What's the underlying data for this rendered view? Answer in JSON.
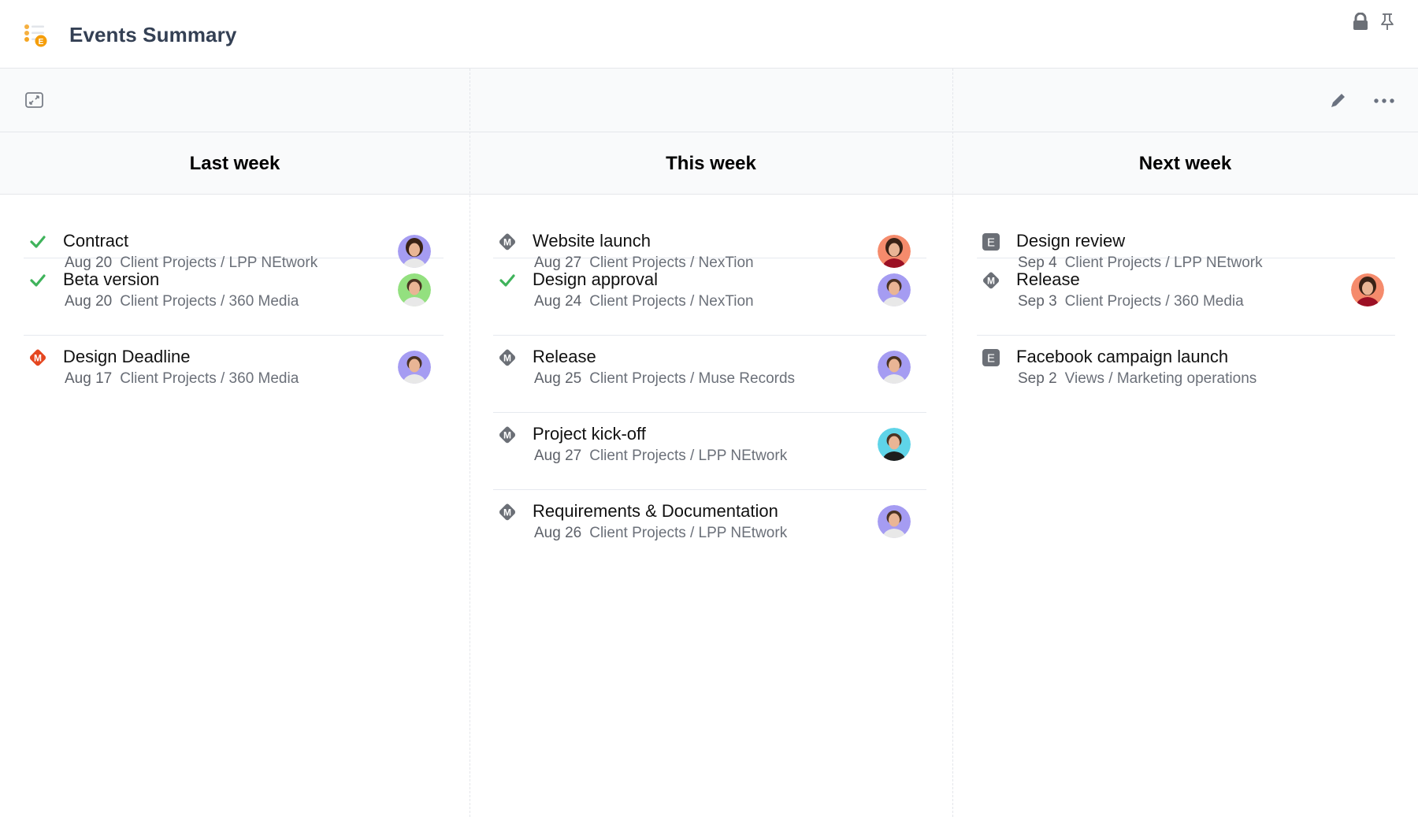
{
  "app": {
    "title": "Events Summary",
    "logo_icon": "list-events-icon",
    "accent_color": "#f59e0b"
  },
  "header_actions": [
    {
      "name": "lock",
      "icon": "lock-icon"
    },
    {
      "name": "pin",
      "icon": "pin-icon"
    }
  ],
  "toolbar": {
    "expand_icon": "expand-icon",
    "edit_icon": "pencil-icon",
    "more_icon": "more-horizontal-icon"
  },
  "status_colors": {
    "done": "#3fb35b",
    "milestone_overdue": "#e5461f",
    "milestone": "#6b6f76",
    "event": "#6b6f76"
  },
  "columns": [
    {
      "label": "Last week",
      "items": [
        {
          "title": "Contract",
          "date": "Aug 20",
          "path": "Client Projects / LPP NEtwork",
          "type": "done",
          "avatar": "woman-brown-hair",
          "avatar_bg": "#a59cf2"
        },
        {
          "title": "Beta version",
          "date": "Aug 20",
          "path": "Client Projects / 360 Media",
          "type": "done",
          "avatar": "man-short-hair",
          "avatar_bg": "#93e07f"
        },
        {
          "title": "Design Deadline",
          "date": "Aug 17",
          "path": "Client Projects / 360 Media",
          "type": "milestone_overdue",
          "badge": "M",
          "avatar": "man-curly-glasses",
          "avatar_bg": "#a59cf2"
        }
      ]
    },
    {
      "label": "This week",
      "items": [
        {
          "title": "Website launch",
          "date": "Aug 27",
          "path": "Client Projects / NexTion",
          "type": "milestone",
          "badge": "M",
          "avatar": "woman-dark-hair",
          "avatar_bg": "#f58b6c"
        },
        {
          "title": "Design approval",
          "date": "Aug 24",
          "path": "Client Projects / NexTion",
          "type": "done",
          "avatar": "man-curly-glasses",
          "avatar_bg": "#a59cf2"
        },
        {
          "title": "Release",
          "date": "Aug 25",
          "path": "Client Projects / Muse Records",
          "type": "milestone",
          "badge": "M",
          "avatar": "man-curly-glasses",
          "avatar_bg": "#a59cf2"
        },
        {
          "title": "Project kick-off",
          "date": "Aug 27",
          "path": "Client Projects / LPP NEtwork",
          "type": "milestone",
          "badge": "M",
          "avatar": "man-dark-tshirt",
          "avatar_bg": "#5fd4e8"
        },
        {
          "title": "Requirements & Documentation",
          "date": "Aug 26",
          "path": "Client Projects / LPP NEtwork",
          "type": "milestone",
          "badge": "M",
          "avatar": "man-curly-glasses",
          "avatar_bg": "#a59cf2"
        }
      ]
    },
    {
      "label": "Next week",
      "items": [
        {
          "title": "Design review",
          "date": "Sep 4",
          "path": "Client Projects / LPP NEtwork",
          "type": "event",
          "badge": "E"
        },
        {
          "title": "Release",
          "date": "Sep 3",
          "path": "Client Projects / 360 Media",
          "type": "milestone",
          "badge": "M",
          "avatar": "woman-dark-hair",
          "avatar_bg": "#f58b6c"
        },
        {
          "title": "Facebook campaign launch",
          "date": "Sep 2",
          "path": "Views / Marketing operations",
          "type": "event",
          "badge": "E"
        }
      ]
    }
  ]
}
